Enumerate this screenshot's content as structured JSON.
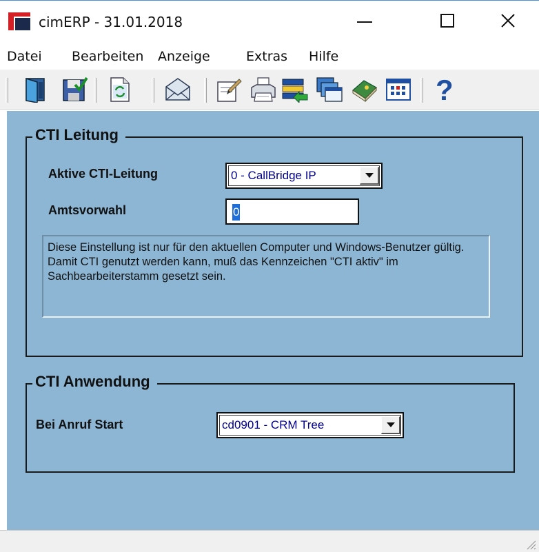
{
  "window": {
    "title": "cimERP - 31.01.2018",
    "minimize_symbol": "—",
    "maximize_symbol": "☐",
    "close_symbol": "✕"
  },
  "menu": {
    "items": [
      "Datei",
      "Bearbeiten",
      "Anzeige",
      "Extras",
      "Hilfe"
    ]
  },
  "toolbar": {
    "icons": [
      "exit-door-icon",
      "save-icon",
      "refresh-icon",
      "mail-icon",
      "notes-icon",
      "print-icon",
      "import-icon",
      "windows-icon",
      "book-icon",
      "calendar-icon",
      "help-icon"
    ]
  },
  "cti_line": {
    "title": "CTI Leitung",
    "active_line_label": "Aktive CTI-Leitung",
    "active_line_value": "0 - CallBridge IP",
    "prefix_label": "Amtsvorwahl",
    "prefix_value": "0",
    "info_text": "Diese Einstellung ist nur für den aktuellen Computer und Windows-Benutzer gültig. Damit CTI genutzt werden kann, muß das Kennzeichen \"CTI aktiv\" im Sachbearbeiterstamm gesetzt sein."
  },
  "cti_app": {
    "title": "CTI Anwendung",
    "on_call_label": "Bei Anruf Start",
    "on_call_value": "cd0901 - CRM Tree"
  },
  "colors": {
    "panel_bg": "#8db6d4",
    "logo_red": "#d31f26",
    "value_text": "#00008b"
  }
}
